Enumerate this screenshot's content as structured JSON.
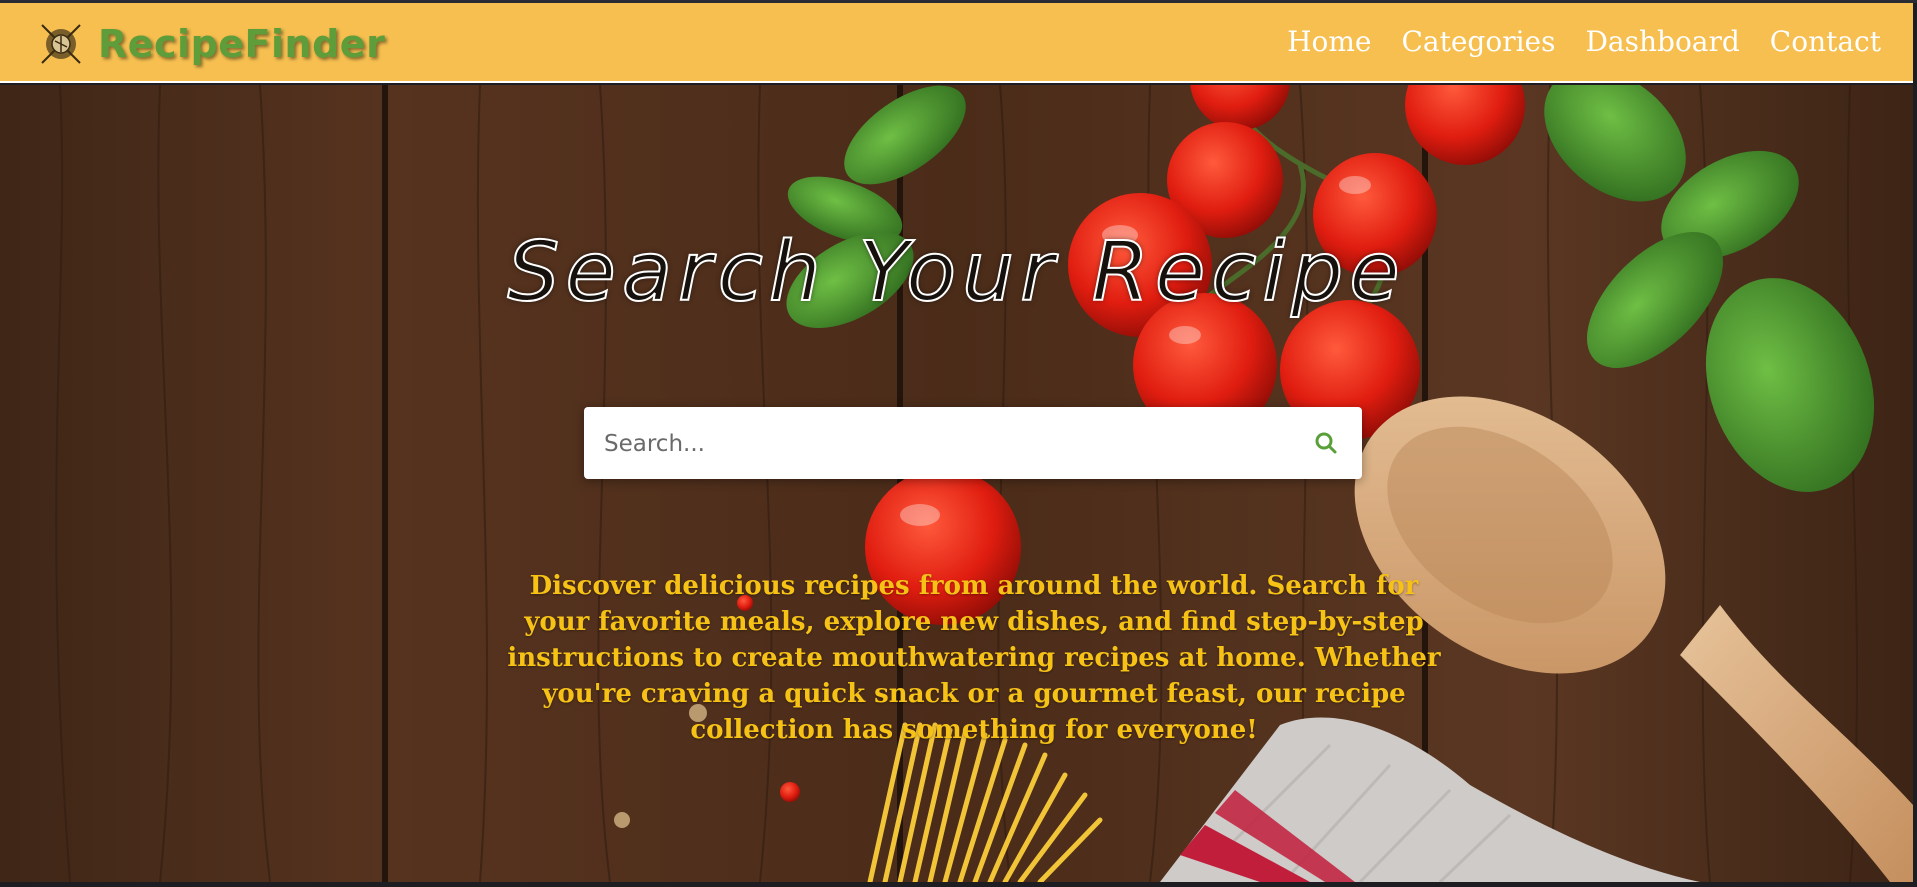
{
  "brand": {
    "name": "RecipeFinder",
    "logo_icon": "whisk-logo-icon"
  },
  "nav": {
    "items": [
      {
        "label": "Home"
      },
      {
        "label": "Categories"
      },
      {
        "label": "Dashboard"
      },
      {
        "label": "Contact"
      }
    ]
  },
  "hero": {
    "title": "Search Your Recipe",
    "description": "Discover delicious recipes from around the world. Search for your favorite meals, explore new dishes, and find step-by-step instructions to create mouthwatering recipes at home. Whether you're craving a quick snack or a gourmet feast, our recipe collection has something for everyone!",
    "background_image": "kitchen-table-tomatoes-basil-pasta-spoon"
  },
  "search": {
    "placeholder": "Search...",
    "value": "",
    "icon": "search-icon"
  },
  "colors": {
    "navbar": "#f6bf50",
    "brand_text": "#5e9d3a",
    "nav_text": "#ffffff",
    "description_text": "#f7c216",
    "search_icon": "#5aa03a"
  }
}
